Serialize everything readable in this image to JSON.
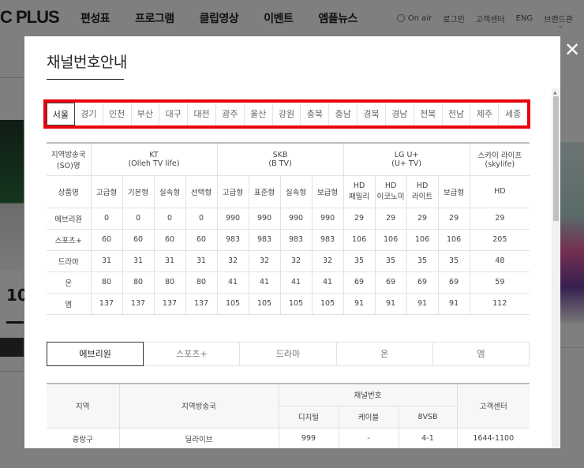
{
  "site": {
    "logo": "C PLUS",
    "nav": [
      "편성표",
      "프로그램",
      "클립영상",
      "이벤트",
      "엠플뉴스"
    ],
    "util": {
      "onair": "On air",
      "login": "로그인",
      "support": "고객센터",
      "lang": "ENG",
      "brand": "브랜드관"
    },
    "bg_number": "10"
  },
  "modal": {
    "title": "채널번호안내",
    "close_icon": "close-icon",
    "region_tabs": [
      "서울",
      "경기",
      "인천",
      "부산",
      "대구",
      "대전",
      "광주",
      "울산",
      "강원",
      "충북",
      "충남",
      "경북",
      "경남",
      "전북",
      "전남",
      "제주",
      "세종"
    ],
    "active_region": 0,
    "channel_table": {
      "corner_label": [
        "지역방송국",
        "(SO)명"
      ],
      "providers": [
        {
          "name": "KT",
          "sub": "(Olleh TV life)"
        },
        {
          "name": "SKB",
          "sub": "(B TV)"
        },
        {
          "name": "LG U+",
          "sub": "(U+ TV)"
        },
        {
          "name": "스카이 라이프",
          "sub": "(skylife)"
        }
      ],
      "product_label": "상품명",
      "products": [
        [
          "고급형"
        ],
        [
          "기본형"
        ],
        [
          "실속형"
        ],
        [
          "선택형"
        ],
        [
          "고급형"
        ],
        [
          "표준형"
        ],
        [
          "실속형"
        ],
        [
          "보급형"
        ],
        [
          "HD",
          "패밀리"
        ],
        [
          "HD",
          "이코노미"
        ],
        [
          "HD",
          "라이트"
        ],
        [
          "보급형"
        ],
        [
          "HD"
        ]
      ],
      "rows": [
        {
          "name": "에브리원",
          "values": [
            "0",
            "0",
            "0",
            "0",
            "990",
            "990",
            "990",
            "990",
            "29",
            "29",
            "29",
            "29",
            "29"
          ]
        },
        {
          "name": "스포츠+",
          "values": [
            "60",
            "60",
            "60",
            "60",
            "983",
            "983",
            "983",
            "983",
            "106",
            "106",
            "106",
            "106",
            "205"
          ]
        },
        {
          "name": "드라마",
          "values": [
            "31",
            "31",
            "31",
            "31",
            "32",
            "32",
            "32",
            "32",
            "35",
            "35",
            "35",
            "35",
            "48"
          ]
        },
        {
          "name": "온",
          "values": [
            "80",
            "80",
            "80",
            "80",
            "41",
            "41",
            "41",
            "41",
            "69",
            "69",
            "69",
            "69",
            "59"
          ]
        },
        {
          "name": "엠",
          "values": [
            "137",
            "137",
            "137",
            "137",
            "105",
            "105",
            "105",
            "105",
            "91",
            "91",
            "91",
            "91",
            "112"
          ]
        }
      ]
    },
    "genre_tabs": [
      "에브리원",
      "스포츠+",
      "드라마",
      "온",
      "엠"
    ],
    "active_genre": 0,
    "detail_table": {
      "headers": {
        "region": "지역",
        "station": "지역방송국",
        "channel_no": "채널번호",
        "support": "고객센터"
      },
      "sub_headers": [
        "디지털",
        "케이블",
        "8VSB"
      ],
      "rows": [
        {
          "region": "중랑구",
          "station": "딜라이브",
          "digital": "999",
          "cable": "-",
          "vsb": "4-1",
          "support": "1644-1100"
        }
      ]
    }
  }
}
